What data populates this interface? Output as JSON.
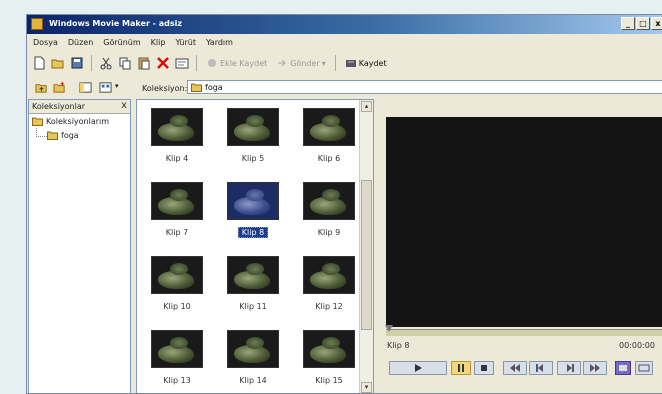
{
  "window": {
    "title": "Windows Movie Maker - adsiz",
    "controls": {
      "minimize": "_",
      "maximize": "□",
      "close": "x"
    }
  },
  "menu": [
    "Dosya",
    "Düzen",
    "Görünüm",
    "Klip",
    "Yürüt",
    "Yardım"
  ],
  "toolbar": {
    "record_label": "Ekle Kaydet",
    "send_label": "Gönder",
    "save_label": "Kaydet"
  },
  "collection_bar": {
    "label": "Koleksiyon:",
    "value": "foga"
  },
  "collections_panel": {
    "title": "Koleksiyonlar",
    "close": "x",
    "root": "Koleksiyonlarım",
    "child": "foga"
  },
  "clips": [
    {
      "label": "Klip 4"
    },
    {
      "label": "Klip 5"
    },
    {
      "label": "Klip 6"
    },
    {
      "label": "Klip 7"
    },
    {
      "label": "Klip 8",
      "selected": true
    },
    {
      "label": "Klip 9"
    },
    {
      "label": "Klip 10"
    },
    {
      "label": "Klip 11"
    },
    {
      "label": "Klip 12"
    },
    {
      "label": "Klip 13"
    },
    {
      "label": "Klip 14"
    },
    {
      "label": "Klip 15"
    }
  ],
  "monitor": {
    "clip_name": "Klip 8",
    "time": "00:00:00"
  },
  "colors": {
    "selection": "#1c3b8c",
    "monitor_bg": "#141414",
    "seekbar": "#cfcfa8"
  },
  "player_buttons": [
    {
      "icon": "play-icon"
    },
    {
      "icon": "pause-icon"
    },
    {
      "icon": "stop-icon"
    },
    {
      "icon": "rewind-icon"
    },
    {
      "icon": "prev-frame-icon"
    },
    {
      "icon": "next-frame-icon"
    },
    {
      "icon": "fast-forward-icon"
    },
    {
      "icon": "snapshot-icon"
    },
    {
      "icon": "fullscreen-icon"
    }
  ]
}
